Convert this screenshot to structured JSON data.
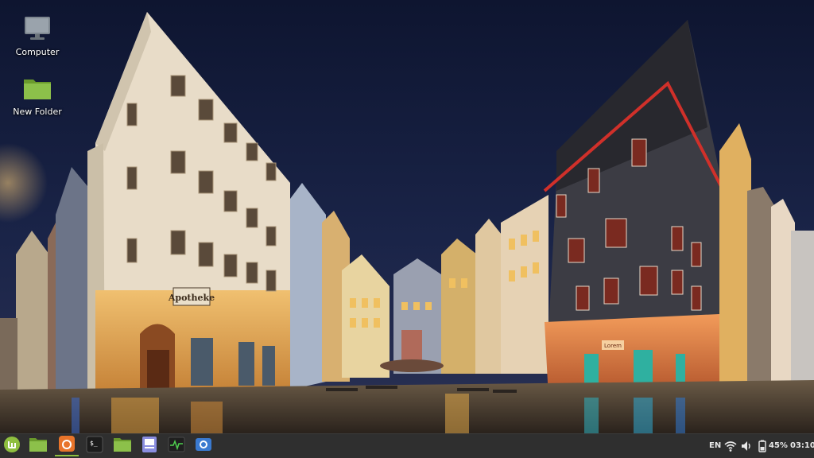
{
  "desktop": {
    "icons": [
      {
        "label": "Computer",
        "icon": "computer-icon"
      },
      {
        "label": "New Folder",
        "icon": "folder-icon"
      }
    ],
    "wallpaper": {
      "sign_left": "Apotheke",
      "sign_right": "Lorem"
    }
  },
  "taskbar": {
    "launchers": [
      {
        "name": "menu",
        "icon": "mint-menu-icon"
      },
      {
        "name": "show-desktop",
        "icon": "desktop-icon"
      },
      {
        "name": "firefox",
        "icon": "firefox-icon"
      },
      {
        "name": "terminal",
        "icon": "terminal-icon"
      },
      {
        "name": "files",
        "icon": "folder-icon"
      },
      {
        "name": "notes",
        "icon": "notes-icon"
      },
      {
        "name": "system-monitor",
        "icon": "system-monitor-icon"
      },
      {
        "name": "screenshot",
        "icon": "screenshot-icon"
      }
    ],
    "tray": {
      "keyboard_layout": "EN",
      "battery_percent": "45%",
      "clock": "03:10"
    }
  },
  "colors": {
    "accent": "#8fbf3f",
    "panel": "#2f2f2f",
    "sky": "#141c3a"
  }
}
